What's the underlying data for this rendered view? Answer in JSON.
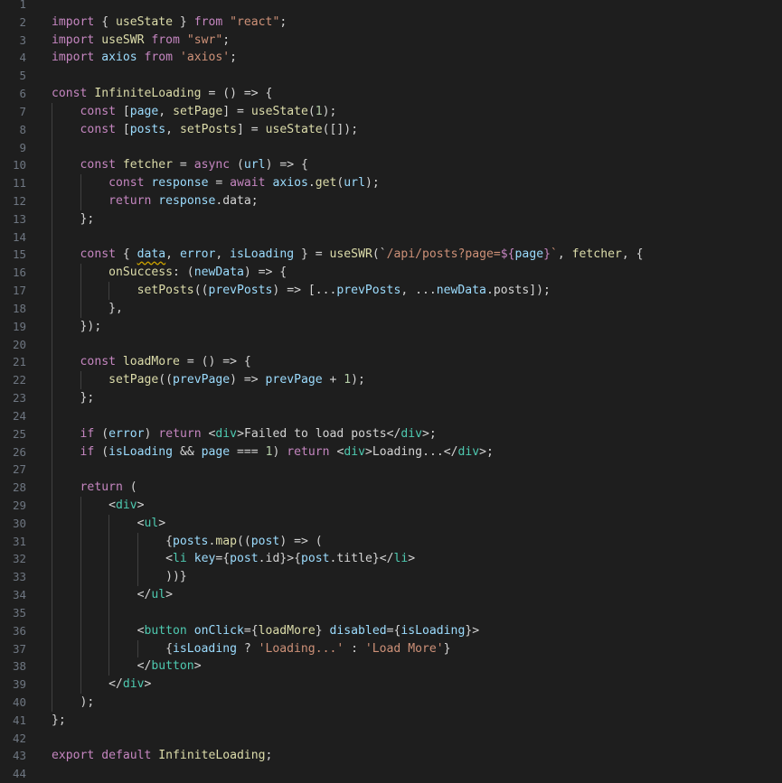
{
  "theme": {
    "background": "#1e1e1e",
    "line_number_color": "#6e7681",
    "default_text": "#d4d4d4",
    "keyword_color": "#c586c0",
    "string_color": "#ce9178",
    "function_color": "#dcdcaa",
    "variable_color": "#9cdcfe",
    "number_color": "#b5cea8",
    "tag_color": "#4ec9b0"
  },
  "editor": {
    "language": "javascript-react",
    "warning_squiggle_on": "data",
    "lines": [
      {
        "n": "1",
        "tokens": []
      },
      {
        "n": "2",
        "tokens": [
          [
            "import",
            "kw"
          ],
          [
            " { ",
            "p"
          ],
          [
            "useState",
            "fn"
          ],
          [
            " } ",
            "p"
          ],
          [
            "from",
            "kw"
          ],
          [
            " ",
            "p"
          ],
          [
            "\"react\"",
            "str"
          ],
          [
            ";",
            "p"
          ]
        ]
      },
      {
        "n": "3",
        "tokens": [
          [
            "import",
            "kw"
          ],
          [
            " ",
            "p"
          ],
          [
            "useSWR",
            "fn"
          ],
          [
            " ",
            "p"
          ],
          [
            "from",
            "kw"
          ],
          [
            " ",
            "p"
          ],
          [
            "\"swr\"",
            "str"
          ],
          [
            ";",
            "p"
          ]
        ]
      },
      {
        "n": "4",
        "tokens": [
          [
            "import",
            "kw"
          ],
          [
            " ",
            "p"
          ],
          [
            "axios",
            "var"
          ],
          [
            " ",
            "p"
          ],
          [
            "from",
            "kw"
          ],
          [
            " ",
            "p"
          ],
          [
            "'axios'",
            "str"
          ],
          [
            ";",
            "p"
          ]
        ]
      },
      {
        "n": "5",
        "tokens": []
      },
      {
        "n": "6",
        "tokens": [
          [
            "const",
            "kw"
          ],
          [
            " ",
            "p"
          ],
          [
            "InfiniteLoading",
            "fn"
          ],
          [
            " = () => {",
            "p"
          ]
        ]
      },
      {
        "n": "7",
        "tokens": [
          [
            "    ",
            "p"
          ],
          [
            "const",
            "kw"
          ],
          [
            " [",
            "p"
          ],
          [
            "page",
            "var"
          ],
          [
            ", ",
            "p"
          ],
          [
            "setPage",
            "fn"
          ],
          [
            "] = ",
            "p"
          ],
          [
            "useState",
            "fn"
          ],
          [
            "(",
            "p"
          ],
          [
            "1",
            "num"
          ],
          [
            ");",
            "p"
          ]
        ]
      },
      {
        "n": "8",
        "tokens": [
          [
            "    ",
            "p"
          ],
          [
            "const",
            "kw"
          ],
          [
            " [",
            "p"
          ],
          [
            "posts",
            "var"
          ],
          [
            ", ",
            "p"
          ],
          [
            "setPosts",
            "fn"
          ],
          [
            "] = ",
            "p"
          ],
          [
            "useState",
            "fn"
          ],
          [
            "([]);",
            "p"
          ]
        ]
      },
      {
        "n": "9",
        "tokens": []
      },
      {
        "n": "10",
        "tokens": [
          [
            "    ",
            "p"
          ],
          [
            "const",
            "kw"
          ],
          [
            " ",
            "p"
          ],
          [
            "fetcher",
            "fn"
          ],
          [
            " = ",
            "p"
          ],
          [
            "async",
            "kw"
          ],
          [
            " (",
            "p"
          ],
          [
            "url",
            "var"
          ],
          [
            ") => {",
            "p"
          ]
        ]
      },
      {
        "n": "11",
        "tokens": [
          [
            "        ",
            "p"
          ],
          [
            "const",
            "kw"
          ],
          [
            " ",
            "p"
          ],
          [
            "response",
            "var"
          ],
          [
            " = ",
            "p"
          ],
          [
            "await",
            "kw"
          ],
          [
            " ",
            "p"
          ],
          [
            "axios",
            "var"
          ],
          [
            ".",
            "p"
          ],
          [
            "get",
            "fn"
          ],
          [
            "(",
            "p"
          ],
          [
            "url",
            "var"
          ],
          [
            ");",
            "p"
          ]
        ]
      },
      {
        "n": "12",
        "tokens": [
          [
            "        ",
            "p"
          ],
          [
            "return",
            "kw"
          ],
          [
            " ",
            "p"
          ],
          [
            "response",
            "var"
          ],
          [
            ".data;",
            "p"
          ]
        ]
      },
      {
        "n": "13",
        "tokens": [
          [
            "    ",
            "p"
          ],
          [
            "};",
            "p"
          ]
        ]
      },
      {
        "n": "14",
        "tokens": []
      },
      {
        "n": "15",
        "tokens": [
          [
            "    ",
            "p"
          ],
          [
            "const",
            "kw"
          ],
          [
            " { ",
            "p"
          ],
          [
            "data",
            "squig"
          ],
          [
            ", ",
            "p"
          ],
          [
            "error",
            "var"
          ],
          [
            ", ",
            "p"
          ],
          [
            "isLoading",
            "var"
          ],
          [
            " } = ",
            "p"
          ],
          [
            "useSWR",
            "fn"
          ],
          [
            "(`",
            "p"
          ],
          [
            "/api/posts?page=",
            "str"
          ],
          [
            "${",
            "kw"
          ],
          [
            "page",
            "var"
          ],
          [
            "}",
            "kw"
          ],
          [
            "`",
            "str"
          ],
          [
            ", ",
            "p"
          ],
          [
            "fetcher",
            "fn"
          ],
          [
            ", {",
            "p"
          ]
        ]
      },
      {
        "n": "16",
        "tokens": [
          [
            "        ",
            "p"
          ],
          [
            "onSuccess",
            "fn"
          ],
          [
            ": (",
            "p"
          ],
          [
            "newData",
            "var"
          ],
          [
            ") => {",
            "p"
          ]
        ]
      },
      {
        "n": "17",
        "tokens": [
          [
            "            ",
            "p"
          ],
          [
            "setPosts",
            "fn"
          ],
          [
            "((",
            "p"
          ],
          [
            "prevPosts",
            "var"
          ],
          [
            ") => [...",
            "p"
          ],
          [
            "prevPosts",
            "var"
          ],
          [
            ", ...",
            "p"
          ],
          [
            "newData",
            "var"
          ],
          [
            ".posts]);",
            "p"
          ]
        ]
      },
      {
        "n": "18",
        "tokens": [
          [
            "        ",
            "p"
          ],
          [
            "},",
            "p"
          ]
        ]
      },
      {
        "n": "19",
        "tokens": [
          [
            "    ",
            "p"
          ],
          [
            "});",
            "p"
          ]
        ]
      },
      {
        "n": "20",
        "tokens": []
      },
      {
        "n": "21",
        "tokens": [
          [
            "    ",
            "p"
          ],
          [
            "const",
            "kw"
          ],
          [
            " ",
            "p"
          ],
          [
            "loadMore",
            "fn"
          ],
          [
            " = () => {",
            "p"
          ]
        ]
      },
      {
        "n": "22",
        "tokens": [
          [
            "        ",
            "p"
          ],
          [
            "setPage",
            "fn"
          ],
          [
            "((",
            "p"
          ],
          [
            "prevPage",
            "var"
          ],
          [
            ") => ",
            "p"
          ],
          [
            "prevPage",
            "var"
          ],
          [
            " + ",
            "p"
          ],
          [
            "1",
            "num"
          ],
          [
            ");",
            "p"
          ]
        ]
      },
      {
        "n": "23",
        "tokens": [
          [
            "    ",
            "p"
          ],
          [
            "};",
            "p"
          ]
        ]
      },
      {
        "n": "24",
        "tokens": []
      },
      {
        "n": "25",
        "tokens": [
          [
            "    ",
            "p"
          ],
          [
            "if",
            "kw"
          ],
          [
            " (",
            "p"
          ],
          [
            "error",
            "var"
          ],
          [
            ") ",
            "p"
          ],
          [
            "return",
            "kw"
          ],
          [
            " <",
            "p"
          ],
          [
            "div",
            "tag"
          ],
          [
            ">Failed to load posts</",
            "p"
          ],
          [
            "div",
            "tag"
          ],
          [
            ">;",
            "p"
          ]
        ]
      },
      {
        "n": "26",
        "tokens": [
          [
            "    ",
            "p"
          ],
          [
            "if",
            "kw"
          ],
          [
            " (",
            "p"
          ],
          [
            "isLoading",
            "var"
          ],
          [
            " && ",
            "p"
          ],
          [
            "page",
            "var"
          ],
          [
            " === ",
            "p"
          ],
          [
            "1",
            "num"
          ],
          [
            ") ",
            "p"
          ],
          [
            "return",
            "kw"
          ],
          [
            " <",
            "p"
          ],
          [
            "div",
            "tag"
          ],
          [
            ">Loading...</",
            "p"
          ],
          [
            "div",
            "tag"
          ],
          [
            ">;",
            "p"
          ]
        ]
      },
      {
        "n": "27",
        "tokens": []
      },
      {
        "n": "28",
        "tokens": [
          [
            "    ",
            "p"
          ],
          [
            "return",
            "kw"
          ],
          [
            " (",
            "p"
          ]
        ]
      },
      {
        "n": "29",
        "tokens": [
          [
            "        <",
            "p"
          ],
          [
            "div",
            "tag"
          ],
          [
            ">",
            "p"
          ]
        ]
      },
      {
        "n": "30",
        "tokens": [
          [
            "            <",
            "p"
          ],
          [
            "ul",
            "tag"
          ],
          [
            ">",
            "p"
          ]
        ]
      },
      {
        "n": "31",
        "tokens": [
          [
            "                {",
            "p"
          ],
          [
            "posts",
            "var"
          ],
          [
            ".",
            "p"
          ],
          [
            "map",
            "fn"
          ],
          [
            "((",
            "p"
          ],
          [
            "post",
            "var"
          ],
          [
            ") => (",
            "p"
          ]
        ]
      },
      {
        "n": "32",
        "tokens": [
          [
            "                <",
            "p"
          ],
          [
            "li",
            "tag"
          ],
          [
            " ",
            "p"
          ],
          [
            "key",
            "var"
          ],
          [
            "={",
            "p"
          ],
          [
            "post",
            "var"
          ],
          [
            ".id}>{",
            "p"
          ],
          [
            "post",
            "var"
          ],
          [
            ".title}</",
            "p"
          ],
          [
            "li",
            "tag"
          ],
          [
            ">",
            "p"
          ]
        ]
      },
      {
        "n": "33",
        "tokens": [
          [
            "                ))}",
            "p"
          ]
        ]
      },
      {
        "n": "34",
        "tokens": [
          [
            "            </",
            "p"
          ],
          [
            "ul",
            "tag"
          ],
          [
            ">",
            "p"
          ]
        ]
      },
      {
        "n": "35",
        "tokens": []
      },
      {
        "n": "36",
        "tokens": [
          [
            "            <",
            "p"
          ],
          [
            "button",
            "tag"
          ],
          [
            " ",
            "p"
          ],
          [
            "onClick",
            "var"
          ],
          [
            "={",
            "p"
          ],
          [
            "loadMore",
            "fn"
          ],
          [
            "} ",
            "p"
          ],
          [
            "disabled",
            "var"
          ],
          [
            "={",
            "p"
          ],
          [
            "isLoading",
            "var"
          ],
          [
            "}>",
            "p"
          ]
        ]
      },
      {
        "n": "37",
        "tokens": [
          [
            "                {",
            "p"
          ],
          [
            "isLoading",
            "var"
          ],
          [
            " ? ",
            "p"
          ],
          [
            "'Loading...'",
            "str"
          ],
          [
            " : ",
            "p"
          ],
          [
            "'Load More'",
            "str"
          ],
          [
            "}",
            "p"
          ]
        ]
      },
      {
        "n": "38",
        "tokens": [
          [
            "            </",
            "p"
          ],
          [
            "button",
            "tag"
          ],
          [
            ">",
            "p"
          ]
        ]
      },
      {
        "n": "39",
        "tokens": [
          [
            "        </",
            "p"
          ],
          [
            "div",
            "tag"
          ],
          [
            ">",
            "p"
          ]
        ]
      },
      {
        "n": "40",
        "tokens": [
          [
            "    ",
            "p"
          ],
          [
            ");",
            "p"
          ]
        ]
      },
      {
        "n": "41",
        "tokens": [
          [
            "};",
            "p"
          ]
        ]
      },
      {
        "n": "42",
        "tokens": []
      },
      {
        "n": "43",
        "tokens": [
          [
            "export",
            "kw"
          ],
          [
            " ",
            "p"
          ],
          [
            "default",
            "kw"
          ],
          [
            " ",
            "p"
          ],
          [
            "InfiniteLoading",
            "fn"
          ],
          [
            ";",
            "p"
          ]
        ]
      },
      {
        "n": "44",
        "tokens": []
      }
    ]
  }
}
